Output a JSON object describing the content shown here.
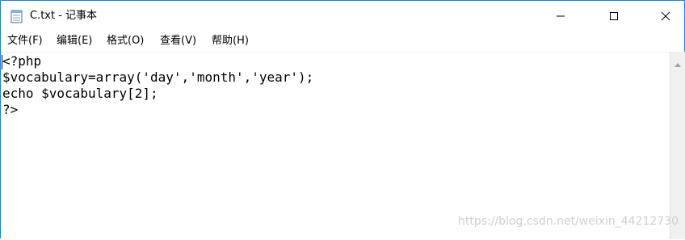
{
  "window": {
    "title": "C.txt - 记事本",
    "border_color": "#1883d7"
  },
  "menu": {
    "items": [
      {
        "label": "文件(F)"
      },
      {
        "label": "编辑(E)"
      },
      {
        "label": "格式(O)"
      },
      {
        "label": "查看(V)"
      },
      {
        "label": "帮助(H)"
      }
    ]
  },
  "editor": {
    "lines": [
      "<?php",
      "$vocabulary=array('day','month','year');",
      "echo $vocabulary[2];",
      "?>"
    ]
  },
  "watermark": "https://blog.csdn.net/weixin_44212730"
}
